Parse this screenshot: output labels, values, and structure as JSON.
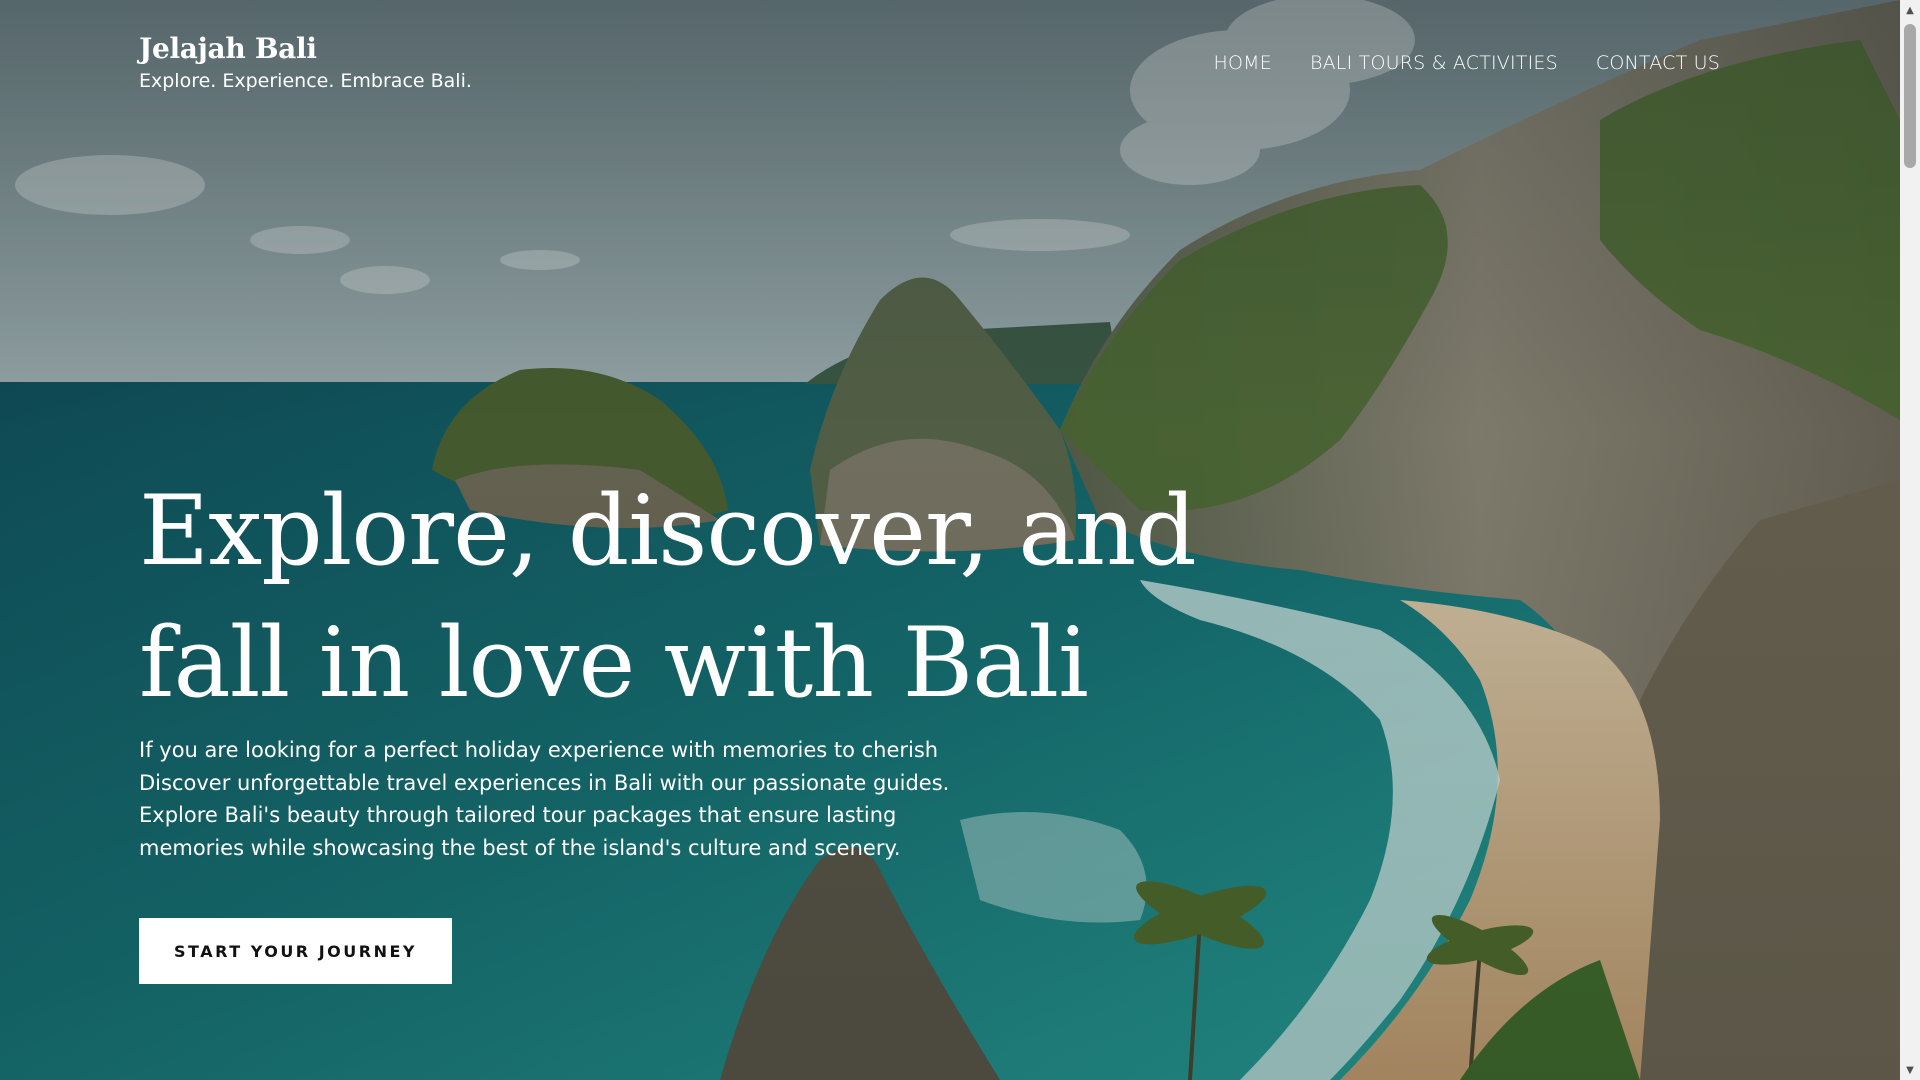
{
  "brand": {
    "name": "Jelajah Bali",
    "tagline": "Explore. Experience. Embrace Bali."
  },
  "nav": {
    "items": [
      {
        "label": "HOME"
      },
      {
        "label": "BALI TOURS & ACTIVITIES"
      },
      {
        "label": "CONTACT US"
      }
    ]
  },
  "hero": {
    "headline_lines": [
      "Explore, discover, and",
      "fall in love with Bali"
    ],
    "lead_lines": [
      "If you are looking for a perfect holiday experience with memories to cherish",
      "Discover unforgettable travel experiences in Bali with our passionate guides.",
      "Explore Bali's beauty through tailored tour packages that ensure lasting",
      "memories while showcasing the best of the island's culture and scenery."
    ],
    "cta_label": "START YOUR JOURNEY",
    "background_icon": "coastal-cliffs-photo"
  },
  "scrollbar": {
    "up_icon": "scroll-up-arrow-icon",
    "down_icon": "scroll-down-arrow-icon"
  },
  "colors": {
    "sea_deep": "#0e5a5e",
    "sea_turquoise": "#1f8f8c",
    "sky": "#8ea3a6",
    "cliff": "#6e6a5c",
    "foliage": "#3f5a2a",
    "sand": "#c9ad86",
    "cta_bg": "#ffffff",
    "text": "#ffffff"
  }
}
